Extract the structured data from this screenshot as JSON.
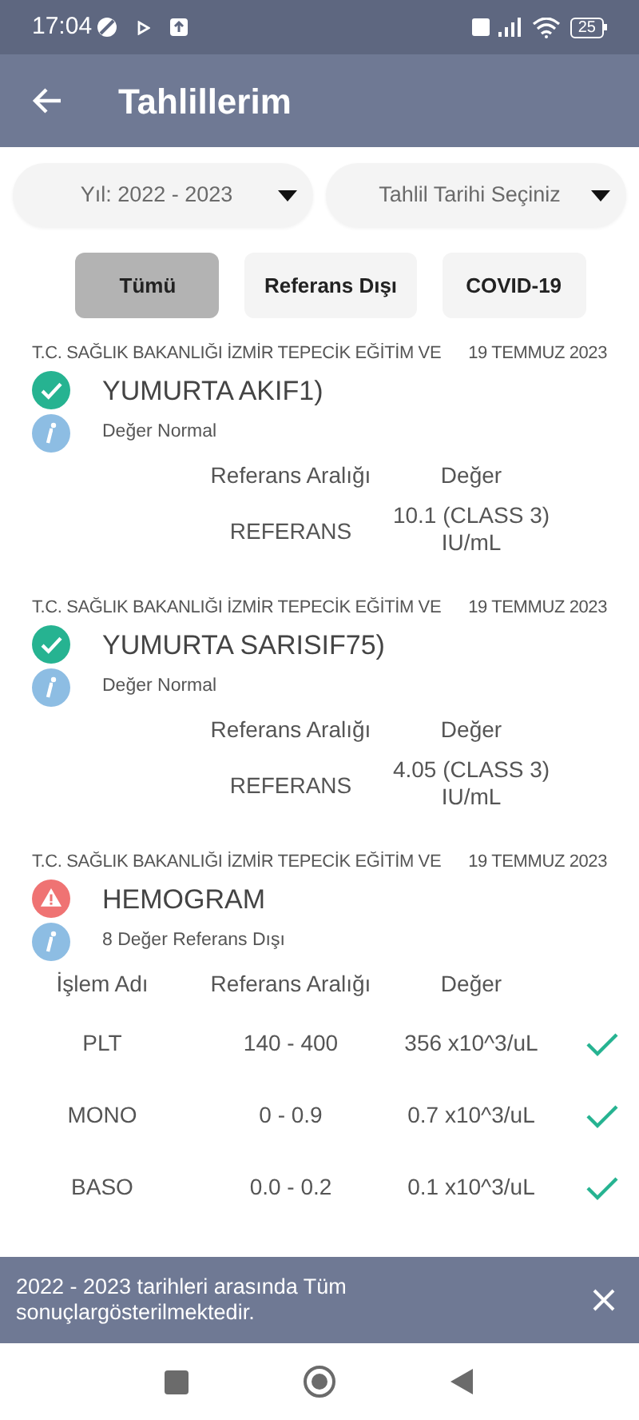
{
  "status_bar": {
    "time": "17:04",
    "battery": "25"
  },
  "app_bar": {
    "title": "Tahlillerim"
  },
  "dropdowns": [
    {
      "label": "Yıl: 2022 - 2023"
    },
    {
      "label": "Tahlil Tarihi Seçiniz"
    }
  ],
  "filters": [
    {
      "label": "Tümü",
      "selected": true
    },
    {
      "label": "Referans Dışı",
      "selected": false
    },
    {
      "label": "COVID-19",
      "selected": false
    }
  ],
  "records": [
    {
      "institution": "T.C. SAĞLIK BAKANLIĞI İZMİR TEPECİK EĞİTİM VE",
      "date": "19 TEMMUZ 2023",
      "title": "YUMURTA AKIF1)",
      "kind": "normal",
      "note": "Değer Normal",
      "columns": {
        "range": "Referans Aralığı",
        "value": "Değer"
      },
      "rows": [
        {
          "range": "REFERANS",
          "value": "10.1 (CLASS 3) IU/mL"
        }
      ]
    },
    {
      "institution": "T.C. SAĞLIK BAKANLIĞI İZMİR TEPECİK EĞİTİM VE",
      "date": "19 TEMMUZ 2023",
      "title": "YUMURTA SARISIF75)",
      "kind": "normal",
      "note": "Değer Normal",
      "columns": {
        "range": "Referans Aralığı",
        "value": "Değer"
      },
      "rows": [
        {
          "range": "REFERANS",
          "value": "4.05 (CLASS 3) IU/mL"
        }
      ]
    },
    {
      "institution": "T.C. SAĞLIK BAKANLIĞI İZMİR TEPECİK EĞİTİM VE",
      "date": "19 TEMMUZ 2023",
      "title": "HEMOGRAM",
      "kind": "out_of_range",
      "note": "8 Değer Referans Dışı",
      "columns": {
        "name": "İşlem Adı",
        "range": "Referans Aralığı",
        "value": "Değer"
      },
      "rows": [
        {
          "name": "PLT",
          "range": "140 - 400",
          "value": "356 x10^3/uL",
          "ok": true
        },
        {
          "name": "MONO",
          "range": "0 - 0.9",
          "value": "0.7 x10^3/uL",
          "ok": true
        },
        {
          "name": "BASO",
          "range": "0.0 - 0.2",
          "value": "0.1 x10^3/uL",
          "ok": true
        }
      ]
    }
  ],
  "banner": {
    "text": "2022 - 2023 tarihleri arasında Tüm sonuçlargösterilmektedir."
  }
}
